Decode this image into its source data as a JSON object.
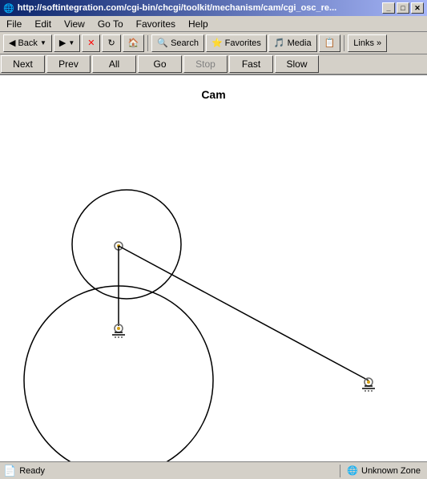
{
  "window": {
    "title": "http://softintegration.com/cgi-bin/chcgi/toolkit/mechanism/cam/cgi_osc_re...",
    "title_short": "http://softintegration.com/cgi-bin/chcgi/toolkit/mechanism/cam/cgi_osc_re...",
    "min_btn": "_",
    "max_btn": "□",
    "close_btn": "✕"
  },
  "menu": {
    "items": [
      "File",
      "Edit",
      "View",
      "Go To",
      "Favorites",
      "Help"
    ]
  },
  "toolbar": {
    "back_label": "Back",
    "forward_label": "→",
    "stop_label": "✕",
    "refresh_label": "↺",
    "home_label": "🏠",
    "search_label": "Search",
    "favorites_label": "Favorites",
    "media_label": "Media",
    "history_label": "→",
    "links_label": "Links »"
  },
  "nav": {
    "next_label": "Next",
    "prev_label": "Prev",
    "all_label": "All",
    "go_label": "Go",
    "stop_label": "Stop",
    "fast_label": "Fast",
    "slow_label": "Slow"
  },
  "content": {
    "title": "Cam"
  },
  "status": {
    "left_label": "Ready",
    "right_label": "Unknown Zone",
    "internet_icon": "🌐"
  }
}
